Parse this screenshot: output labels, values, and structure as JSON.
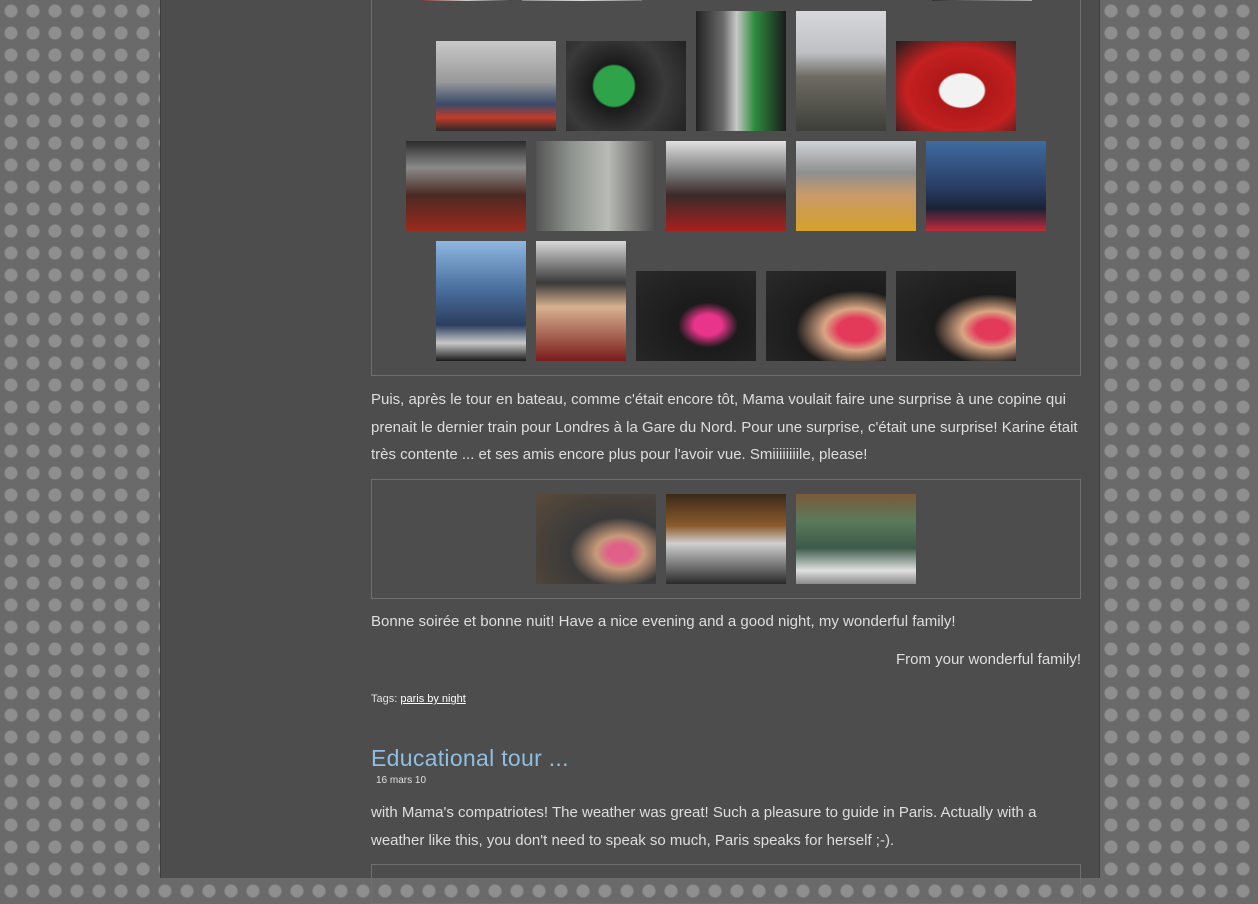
{
  "post1": {
    "para_after_boat": "Puis, après le tour en bateau, comme c'était encore tôt, Mama voulait faire une surprise à une copine qui prenait le dernier train pour Londres à la Gare du Nord. Pour une surprise, c'était une surprise! Karine était très contente ... et ses amis encore plus pour l'avoir vue. Smiiiiiiiile, please!",
    "para_goodnight": "Bonne soirée et bonne nuit! Have a nice evening and a good night, my wonderful family!",
    "signoff": "From your wonderful family!",
    "tags_label": "Tags:",
    "tag_link": "paris by night"
  },
  "post2": {
    "title": "Educational tour ...",
    "date": "16 mars 10",
    "body": "with Mama's compatriotes! The weather was great! Such a pleasure to guide in Paris. Actually with a weather like this, you don't need to speak so much, Paris speaks for herself ;-)."
  },
  "colors": {
    "page_bg": "#4d4d4d",
    "title_blue": "#8fbfe0",
    "frame_border": "#707070"
  }
}
